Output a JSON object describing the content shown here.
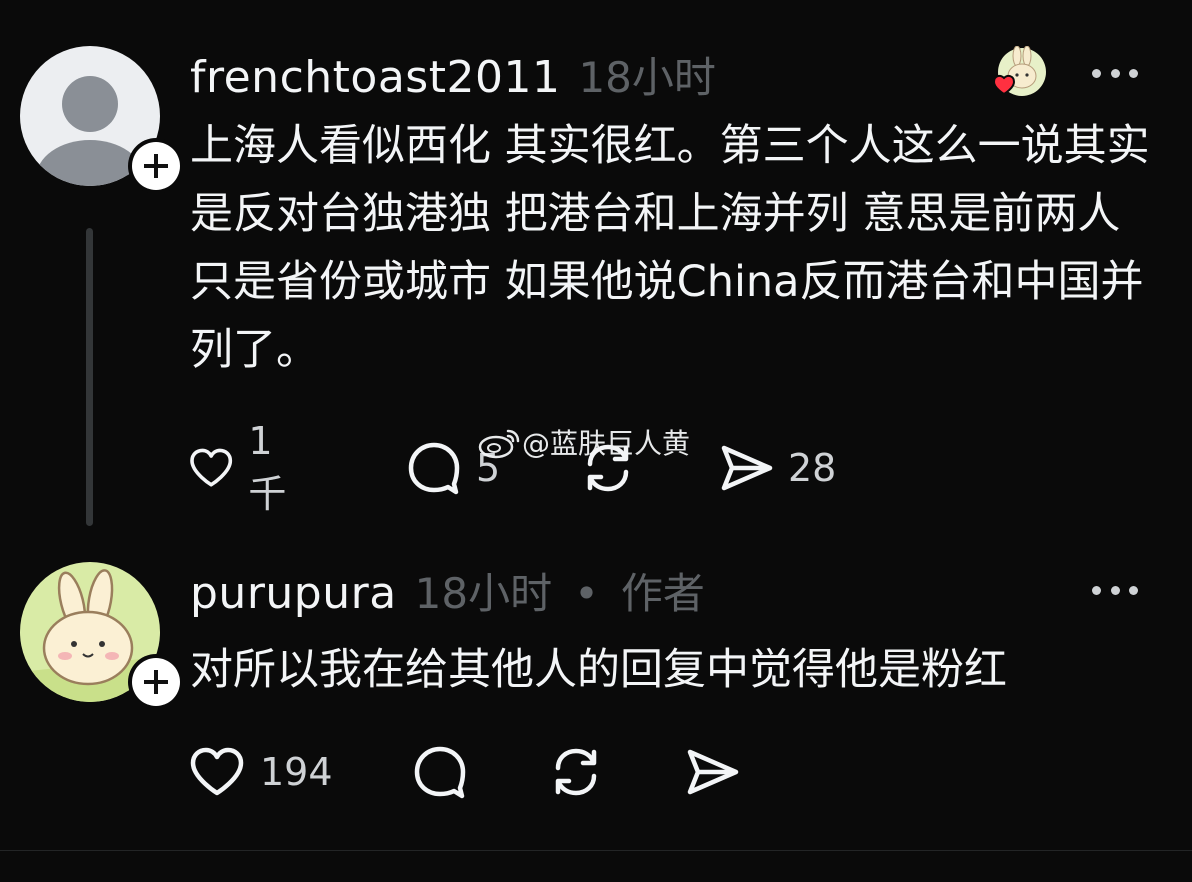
{
  "posts": [
    {
      "username": "frenchtoast2011",
      "time": "18小时",
      "text": "上海人看似西化 其实很红。第三个人这么一说其实是反对台独港独 把港台和上海并列 意思是前两人只是省份或城市 如果他说China反而港台和中国并列了。",
      "like_count": "1千",
      "reply_count": "5",
      "repost_count": "",
      "share_count": "28"
    },
    {
      "username": "purupura",
      "time": "18小时",
      "separator": "•",
      "author_tag": "作者",
      "text": "对所以我在给其他人的回复中觉得他是粉红",
      "like_count": "194",
      "reply_count": "",
      "repost_count": "",
      "share_count": ""
    }
  ],
  "watermark": "@蓝肤巨人黄",
  "colors": {
    "background": "#0a0a0a",
    "text": "#f3f5f7",
    "muted": "#5e6266",
    "heart": "#ff3040"
  }
}
